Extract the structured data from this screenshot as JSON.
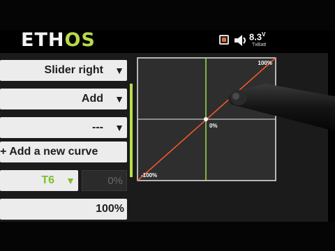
{
  "header": {
    "logo_part1": "ETH",
    "logo_part2": "OS",
    "battery_value": "8.3",
    "battery_unit": "V",
    "battery_label": "TxBatt"
  },
  "curve_settings": {
    "source": "Slider right",
    "function": "Add",
    "curve": "---",
    "add_curve_label": "+ Add a new curve",
    "trim_source": "T6",
    "trim_offset": "0%",
    "weight": "100%"
  },
  "curve_graph": {
    "top_label": "100%",
    "center_label": "0%",
    "bottom_label": "-100%",
    "colors": {
      "curve": "#ff5a2a",
      "crosshair_vertical": "#9fe04a",
      "grid": "#e6e6e6"
    }
  }
}
